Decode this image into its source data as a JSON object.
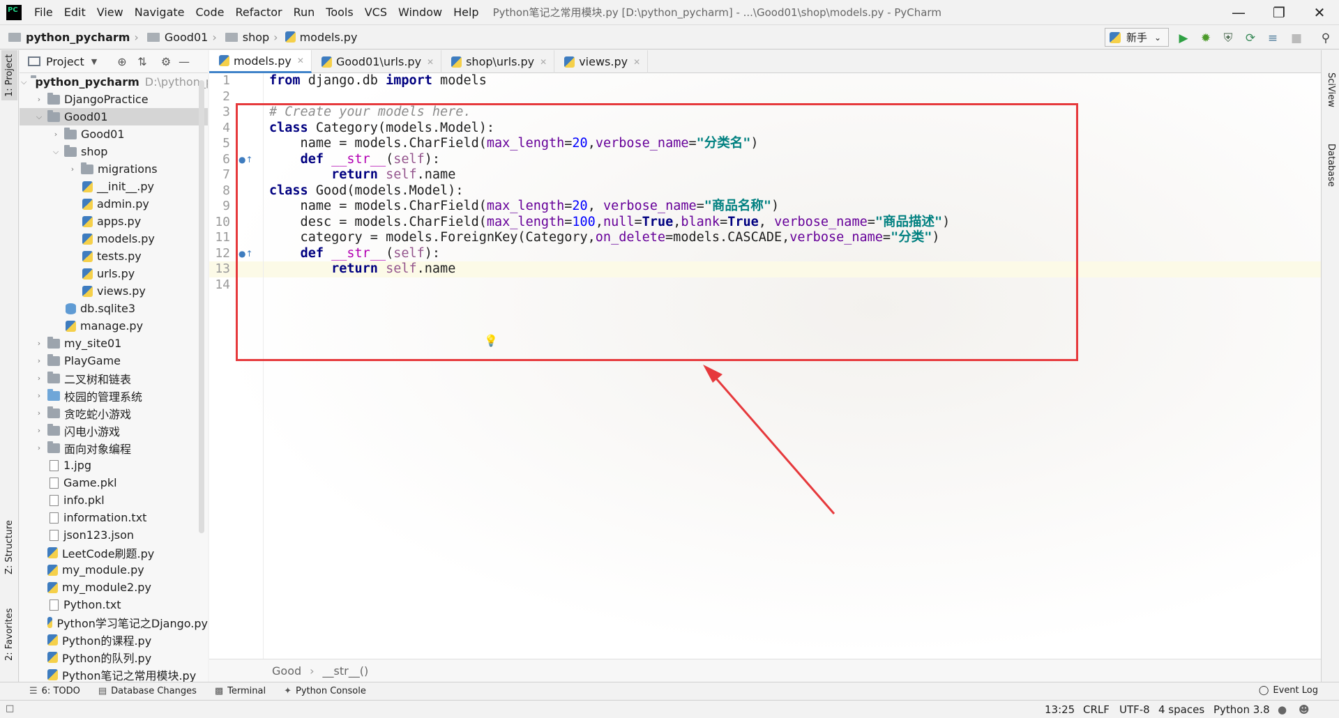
{
  "menubar": {
    "items": [
      "File",
      "Edit",
      "View",
      "Navigate",
      "Code",
      "Refactor",
      "Run",
      "Tools",
      "VCS",
      "Window",
      "Help"
    ],
    "window_title": "Python笔记之常用模块.py [D:\\python_pycharm] - ...\\Good01\\shop\\models.py - PyCharm"
  },
  "navbar": {
    "crumbs": [
      "python_pycharm",
      "Good01",
      "shop",
      "models.py"
    ],
    "run_config": "新手"
  },
  "left_strip": {
    "project": "1: Project",
    "structure": "Z: Structure",
    "favorites": "2: Favorites"
  },
  "right_strip": {
    "sciview": "SciView",
    "database": "Database"
  },
  "project_panel": {
    "title": "Project",
    "tree": [
      {
        "label": "python_pycharm",
        "hint": "D:\\python_p"
      },
      {
        "label": "DjangoPractice"
      },
      {
        "label": "Good01"
      },
      {
        "label": "Good01"
      },
      {
        "label": "shop"
      },
      {
        "label": "migrations"
      },
      {
        "label": "__init__.py"
      },
      {
        "label": "admin.py"
      },
      {
        "label": "apps.py"
      },
      {
        "label": "models.py"
      },
      {
        "label": "tests.py"
      },
      {
        "label": "urls.py"
      },
      {
        "label": "views.py"
      },
      {
        "label": "db.sqlite3"
      },
      {
        "label": "manage.py"
      },
      {
        "label": "my_site01"
      },
      {
        "label": "PlayGame"
      },
      {
        "label": "二叉树和链表"
      },
      {
        "label": "校园的管理系统"
      },
      {
        "label": "贪吃蛇小游戏"
      },
      {
        "label": "闪电小游戏"
      },
      {
        "label": "面向对象编程"
      },
      {
        "label": "1.jpg"
      },
      {
        "label": "Game.pkl"
      },
      {
        "label": "info.pkl"
      },
      {
        "label": "information.txt"
      },
      {
        "label": "json123.json"
      },
      {
        "label": "LeetCode刷题.py"
      },
      {
        "label": "my_module.py"
      },
      {
        "label": "my_module2.py"
      },
      {
        "label": "Python.txt"
      },
      {
        "label": "Python学习笔记之Django.py"
      },
      {
        "label": "Python的课程.py"
      },
      {
        "label": "Python的队列.py"
      },
      {
        "label": "Python笔记之常用模块.py"
      }
    ]
  },
  "editor_tabs": [
    "models.py",
    "Good01\\urls.py",
    "shop\\urls.py",
    "views.py"
  ],
  "editor": {
    "line_numbers": [
      "1",
      "2",
      "3",
      "4",
      "5",
      "6",
      "7",
      "8",
      "9",
      "10",
      "11",
      "12",
      "13",
      "14"
    ],
    "code_crumbs": [
      "Good",
      "__str__()"
    ]
  },
  "bottom_tools": {
    "todo": "6: TODO",
    "db_changes": "Database Changes",
    "terminal": "Terminal",
    "python_console": "Python Console",
    "event_log": "Event Log"
  },
  "statusbar": {
    "position": "13:25",
    "line_sep": "CRLF",
    "encoding": "UTF-8",
    "indent": "4 spaces",
    "interpreter": "Python 3.8"
  },
  "colors": {
    "accent": "#4083c9",
    "highlight_box": "#e6393c"
  }
}
